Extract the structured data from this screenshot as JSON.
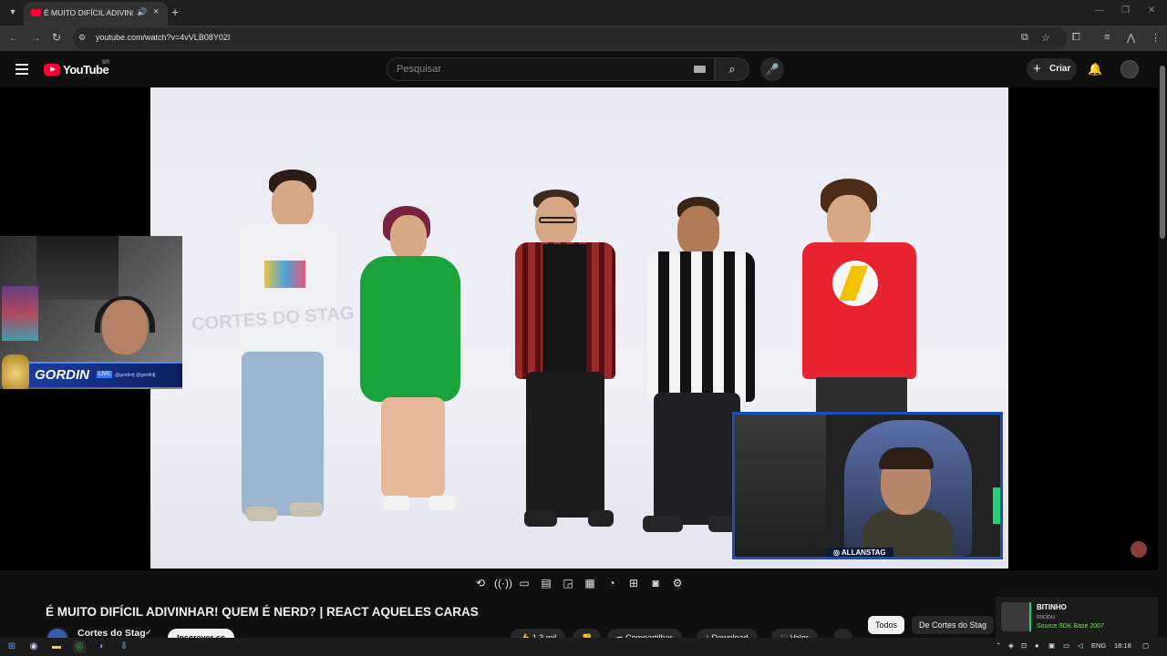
{
  "browser": {
    "tab_title": "É MUITO DIFÍCIL ADIVINHAR! QUEM É NERD? | REACT AQUELES CARAS",
    "url": "youtube.com/watch?v=4vVLB08Y02I"
  },
  "youtube": {
    "logo_text": "YouTube",
    "country_code": "BR",
    "search_placeholder": "Pesquisar",
    "create_label": "Criar"
  },
  "video": {
    "watermark": "CORTES DO STAG",
    "streamer_left_name": "GORDIN",
    "streamer_left_badge": "LIVE",
    "streamer_left_social": "@gordintj  @gordintj",
    "streamer_right_tag": "ALLANSTAG",
    "title": "É MUITO DIFÍCIL ADIVINHAR! QUEM É NERD? | REACT AQUELES CARAS",
    "channel": "Cortes do Stag",
    "subscribe_label": "Inscrever-se",
    "actions": {
      "likes": "1,3 mil",
      "share": "Compartilhar",
      "download": "Download",
      "clip": "Valer"
    }
  },
  "chips": {
    "all": "Todos",
    "from_channel": "De Cortes do Stag"
  },
  "notification": {
    "name": "BITINHO",
    "status": "iniciou",
    "detail": "Source SDK Base 2007"
  },
  "taskbar": {
    "lang": "ENG",
    "time": "18:18"
  },
  "colors": {
    "yt_red": "#ff0033",
    "background": "#0f0f0f",
    "facecam_border": "#1b4fb8"
  }
}
